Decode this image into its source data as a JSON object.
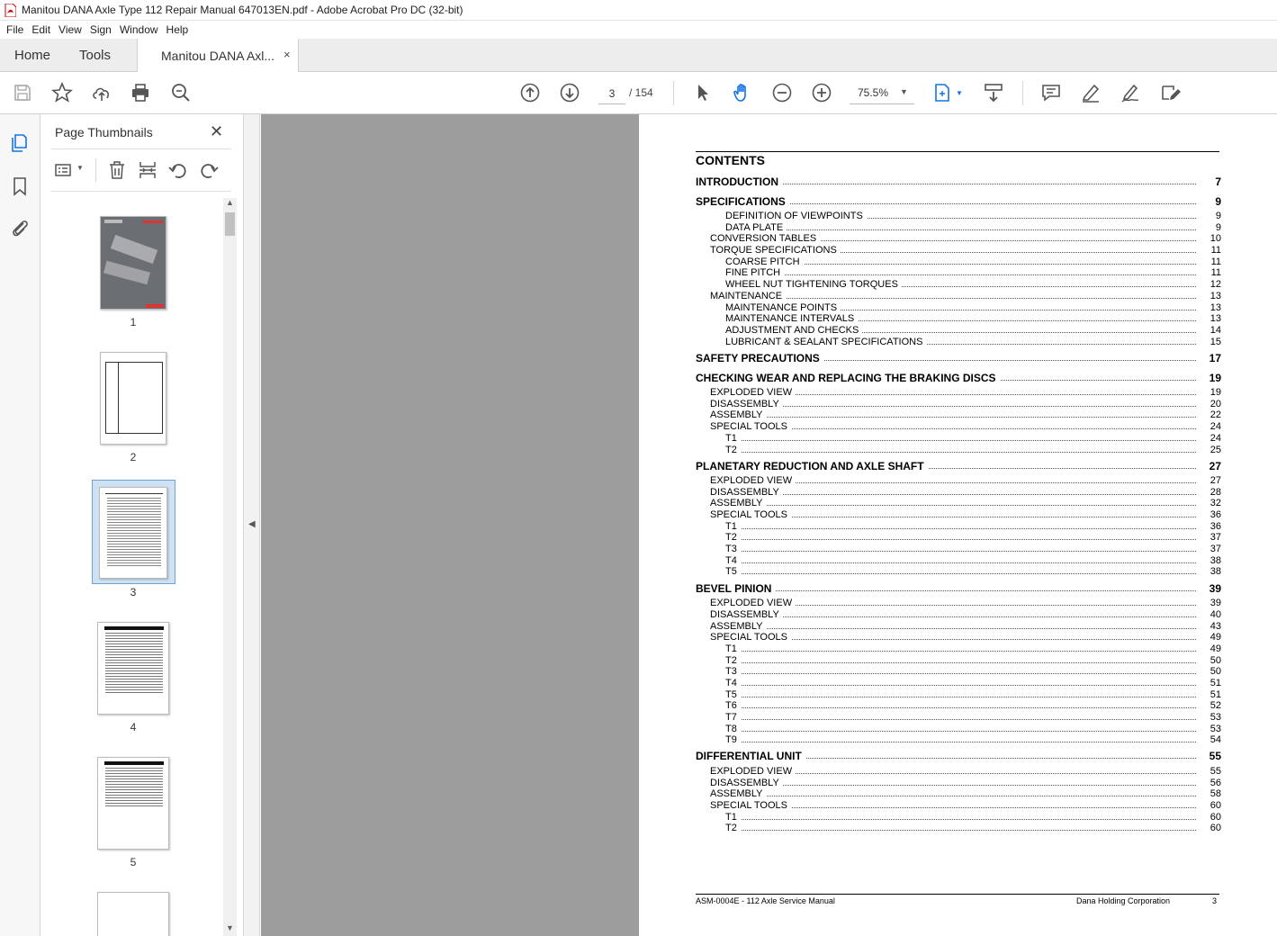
{
  "window": {
    "title": "Manitou DANA Axle Type 112 Repair Manual 647013EN.pdf - Adobe Acrobat Pro DC (32-bit)"
  },
  "menu": [
    "File",
    "Edit",
    "View",
    "Sign",
    "Window",
    "Help"
  ],
  "tabs": {
    "home": "Home",
    "tools": "Tools",
    "document": "Manitou DANA Axl...",
    "close": "×"
  },
  "toolbar": {
    "current_page": "3",
    "total_pages": "/ 154",
    "zoom": "75.5%"
  },
  "thumbnails": {
    "title": "Page Thumbnails",
    "close": "✕",
    "pages": [
      "1",
      "2",
      "3",
      "4",
      "5"
    ],
    "selected": "3"
  },
  "document": {
    "heading": "CONTENTS",
    "toc": [
      {
        "label": "INTRODUCTION",
        "page": "7",
        "level": 0
      },
      {
        "label": "SPECIFICATIONS",
        "page": "9",
        "level": 0
      },
      {
        "label": "DEFINITION OF VIEWPOINTS",
        "page": "9",
        "level": 2
      },
      {
        "label": "DATA PLATE",
        "page": "9",
        "level": 2
      },
      {
        "label": "CONVERSION TABLES",
        "page": "10",
        "level": 1
      },
      {
        "label": "TORQUE SPECIFICATIONS",
        "page": "11",
        "level": 1
      },
      {
        "label": "COARSE PITCH",
        "page": "11",
        "level": 2
      },
      {
        "label": "FINE PITCH",
        "page": "11",
        "level": 2
      },
      {
        "label": "WHEEL NUT TIGHTENING TORQUES",
        "page": "12",
        "level": 2
      },
      {
        "label": "MAINTENANCE",
        "page": "13",
        "level": 1
      },
      {
        "label": "MAINTENANCE POINTS",
        "page": "13",
        "level": 2
      },
      {
        "label": "MAINTENANCE INTERVALS",
        "page": "13",
        "level": 2
      },
      {
        "label": "ADJUSTMENT AND CHECKS",
        "page": "14",
        "level": 2
      },
      {
        "label": "LUBRICANT & SEALANT SPECIFICATIONS",
        "page": "15",
        "level": 2
      },
      {
        "label": "SAFETY PRECAUTIONS",
        "page": "17",
        "level": 0
      },
      {
        "label": "CHECKING WEAR AND REPLACING THE BRAKING DISCS",
        "page": "19",
        "level": 0
      },
      {
        "label": "EXPLODED VIEW",
        "page": "19",
        "level": 1
      },
      {
        "label": "DISASSEMBLY",
        "page": "20",
        "level": 1
      },
      {
        "label": "ASSEMBLY",
        "page": "22",
        "level": 1
      },
      {
        "label": "SPECIAL TOOLS",
        "page": "24",
        "level": 1
      },
      {
        "label": "T1",
        "page": "24",
        "level": 2
      },
      {
        "label": "T2",
        "page": "25",
        "level": 2
      },
      {
        "label": "PLANETARY REDUCTION AND AXLE SHAFT",
        "page": "27",
        "level": 0
      },
      {
        "label": "EXPLODED VIEW",
        "page": "27",
        "level": 1
      },
      {
        "label": "DISASSEMBLY",
        "page": "28",
        "level": 1
      },
      {
        "label": "ASSEMBLY",
        "page": "32",
        "level": 1
      },
      {
        "label": "SPECIAL TOOLS",
        "page": "36",
        "level": 1
      },
      {
        "label": "T1",
        "page": "36",
        "level": 2
      },
      {
        "label": "T2",
        "page": "37",
        "level": 2
      },
      {
        "label": "T3",
        "page": "37",
        "level": 2
      },
      {
        "label": "T4",
        "page": "38",
        "level": 2
      },
      {
        "label": "T5",
        "page": "38",
        "level": 2
      },
      {
        "label": "BEVEL PINION",
        "page": "39",
        "level": 0
      },
      {
        "label": "EXPLODED VIEW",
        "page": "39",
        "level": 1
      },
      {
        "label": "DISASSEMBLY",
        "page": "40",
        "level": 1
      },
      {
        "label": "ASSEMBLY",
        "page": "43",
        "level": 1
      },
      {
        "label": "SPECIAL TOOLS",
        "page": "49",
        "level": 1
      },
      {
        "label": "T1",
        "page": "49",
        "level": 2
      },
      {
        "label": "T2",
        "page": "50",
        "level": 2
      },
      {
        "label": "T3",
        "page": "50",
        "level": 2
      },
      {
        "label": "T4",
        "page": "51",
        "level": 2
      },
      {
        "label": "T5",
        "page": "51",
        "level": 2
      },
      {
        "label": "T6",
        "page": "52",
        "level": 2
      },
      {
        "label": "T7",
        "page": "53",
        "level": 2
      },
      {
        "label": "T8",
        "page": "53",
        "level": 2
      },
      {
        "label": "T9",
        "page": "54",
        "level": 2
      },
      {
        "label": "DIFFERENTIAL UNIT",
        "page": "55",
        "level": 0
      },
      {
        "label": "EXPLODED VIEW",
        "page": "55",
        "level": 1
      },
      {
        "label": "DISASSEMBLY",
        "page": "56",
        "level": 1
      },
      {
        "label": "ASSEMBLY",
        "page": "58",
        "level": 1
      },
      {
        "label": "SPECIAL TOOLS",
        "page": "60",
        "level": 1
      },
      {
        "label": "T1",
        "page": "60",
        "level": 2
      },
      {
        "label": "T2",
        "page": "60",
        "level": 2
      }
    ],
    "footer_left": "ASM-0004E - 112 Axle Service Manual",
    "footer_right": "Dana Holding Corporation",
    "footer_page": "3"
  }
}
